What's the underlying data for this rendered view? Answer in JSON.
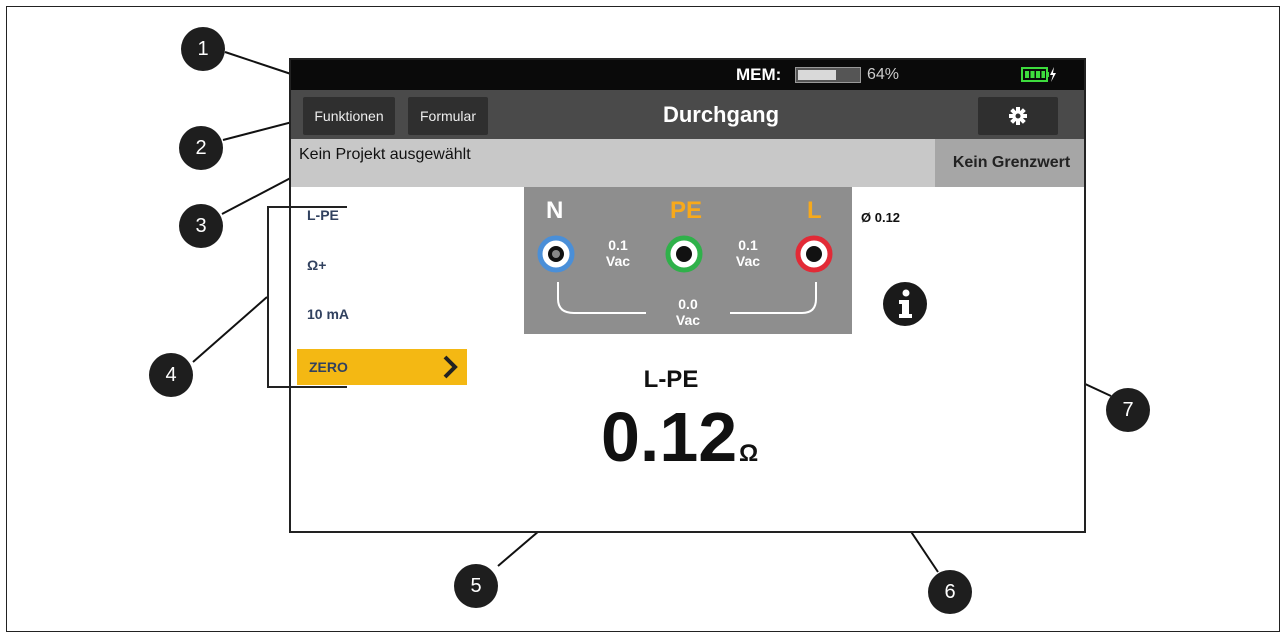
{
  "statusbar": {
    "mem_label": "MEM:",
    "mem_percent": "64%",
    "mem_level": 0.64,
    "battery_icon": "battery-charging-icon"
  },
  "titlebar": {
    "functions_label": "Funktionen",
    "form_label": "Formular",
    "title": "Durchgang",
    "settings_icon": "gear-icon"
  },
  "project": {
    "text": "Kein Projekt ausgewählt",
    "limit": "Kein Grenzwert"
  },
  "menu": {
    "items": [
      "L-PE",
      "Ω+",
      "10 mA"
    ],
    "zero_label": "ZERO"
  },
  "probes": {
    "n_label": "N",
    "pe_label": "PE",
    "l_label": "L",
    "v_n_pe": "0.1",
    "v_n_pe_unit": "Vac",
    "v_pe_l": "0.1",
    "v_pe_l_unit": "Vac",
    "v_n_l": "0.0",
    "v_n_l_unit": "Vac"
  },
  "average": "Ø 0.12",
  "measurement": {
    "label": "L-PE",
    "value": "0.12",
    "unit": "Ω"
  },
  "callouts": [
    "1",
    "2",
    "3",
    "4",
    "5",
    "6",
    "7"
  ],
  "colors": {
    "accent": "#f4b813",
    "probe_n": "#4a8fd8",
    "probe_pe": "#2fb14a",
    "probe_l": "#e22a36",
    "pe_label": "#f7a91b",
    "l_label": "#f7a91b"
  }
}
